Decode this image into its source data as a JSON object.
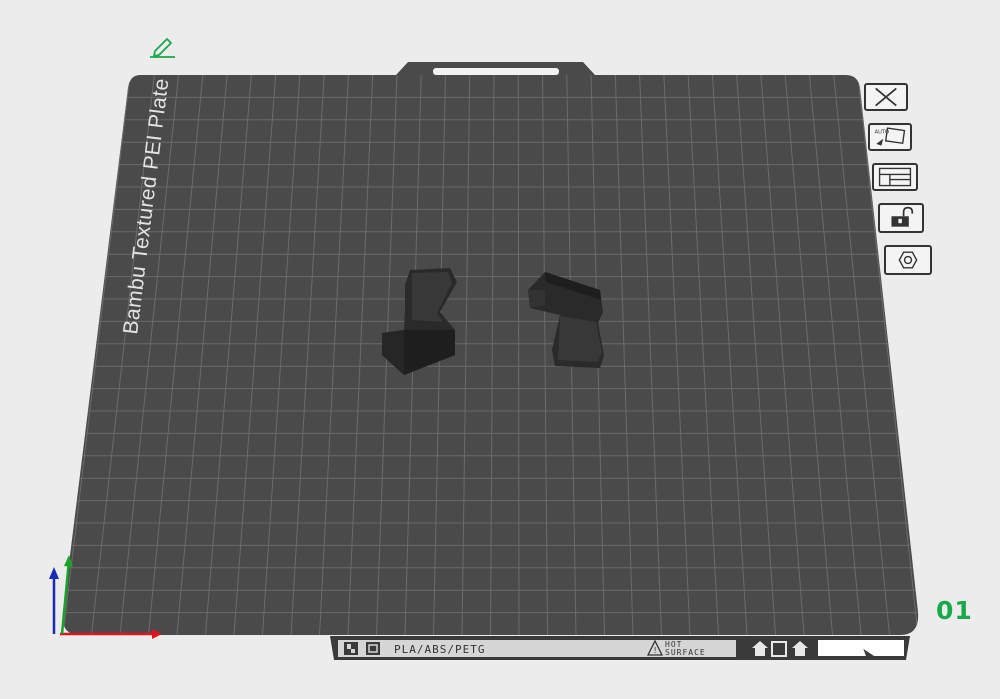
{
  "plate": {
    "name": "Bambu Textured PEI Plate",
    "number": "01",
    "material_label": "PLA/ABS/PETG",
    "warning_line1": "HOT",
    "warning_line2": "SURFACE"
  },
  "toolbar": {
    "buttons": [
      {
        "name": "close-plate-button",
        "icon": "close-icon"
      },
      {
        "name": "auto-orient-button",
        "icon": "auto-orient-icon"
      },
      {
        "name": "arrange-button",
        "icon": "arrange-icon"
      },
      {
        "name": "lock-button",
        "icon": "unlock-icon"
      },
      {
        "name": "plate-settings-button",
        "icon": "hexagon-settings-icon"
      }
    ]
  },
  "colors": {
    "background": "#ececec",
    "plate": "#4a4a4a",
    "grid": "#6b6b6b",
    "accent_green": "#19a84a",
    "axis_x": "#e0141b",
    "axis_y": "#1aa22a",
    "axis_z": "#1a2ab4"
  }
}
